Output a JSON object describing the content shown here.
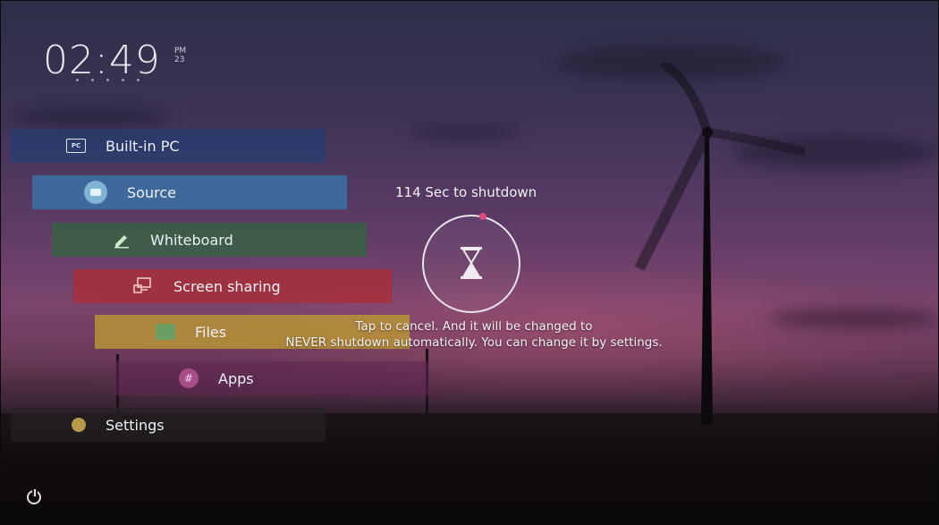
{
  "clock": {
    "time": "02:49",
    "suffix_top": "PM",
    "suffix_bottom": "23"
  },
  "menu": {
    "items": [
      {
        "label": "Built-in PC",
        "icon": "pc-icon",
        "color": "#263c70"
      },
      {
        "label": "Source",
        "icon": "source-icon",
        "color": "#367cb0"
      },
      {
        "label": "Whiteboard",
        "icon": "pen-icon",
        "color": "#346440"
      },
      {
        "label": "Screen sharing",
        "icon": "screen-share-icon",
        "color": "#aa2e34"
      },
      {
        "label": "Files",
        "icon": "folder-icon",
        "color": "#ba9634"
      },
      {
        "label": "Apps",
        "icon": "apps-grid-icon",
        "color": "#622654"
      },
      {
        "label": "Settings",
        "icon": "gear-icon",
        "color": "#282428"
      }
    ]
  },
  "shutdown": {
    "countdown_text": "114 Sec to shutdown",
    "icon": "hourglass-icon",
    "message_line1": "Tap to cancel. And it will be changed to",
    "message_line2": "NEVER shutdown automatically. You can change it by settings."
  },
  "footer": {
    "power_icon": "power-icon"
  }
}
